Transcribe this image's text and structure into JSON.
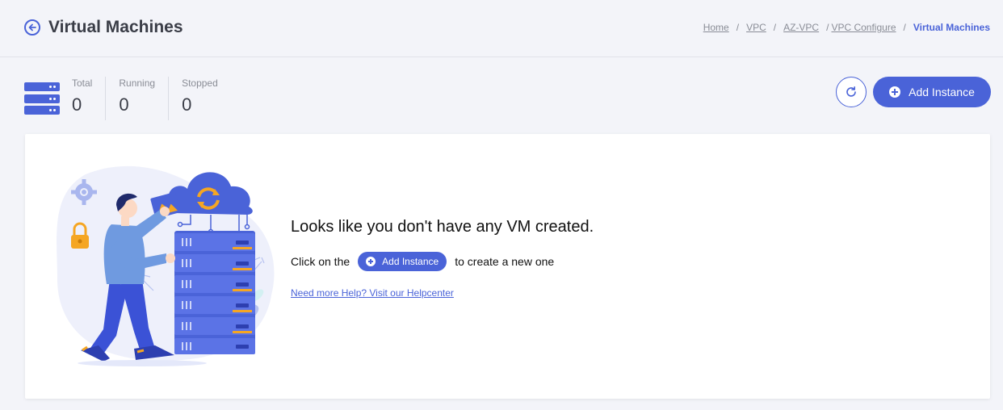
{
  "header": {
    "title": "Virtual Machines",
    "back_icon": "arrow-left-circle-icon",
    "breadcrumb": [
      {
        "label": "Home"
      },
      {
        "label": "VPC"
      },
      {
        "label": "AZ-VPC"
      },
      {
        "label": "VPC Configure"
      },
      {
        "label": "Virtual Machines"
      }
    ]
  },
  "stats": {
    "icon": "server-stack-icon",
    "items": [
      {
        "label": "Total",
        "value": "0"
      },
      {
        "label": "Running",
        "value": "0"
      },
      {
        "label": "Stopped",
        "value": "0"
      }
    ]
  },
  "toolbar": {
    "refresh_icon": "refresh-icon",
    "add_label": "Add Instance"
  },
  "empty_state": {
    "title": "Looks like you don't have any VM created.",
    "prefix": "Click on the",
    "button_label": "Add Instance",
    "suffix": "to create a new one",
    "help_link": "Need more Help? Visit our Helpcenter"
  },
  "colors": {
    "accent": "#4a63d8",
    "background": "#f3f4f9",
    "card": "#ffffff",
    "orange": "#f5a623"
  }
}
